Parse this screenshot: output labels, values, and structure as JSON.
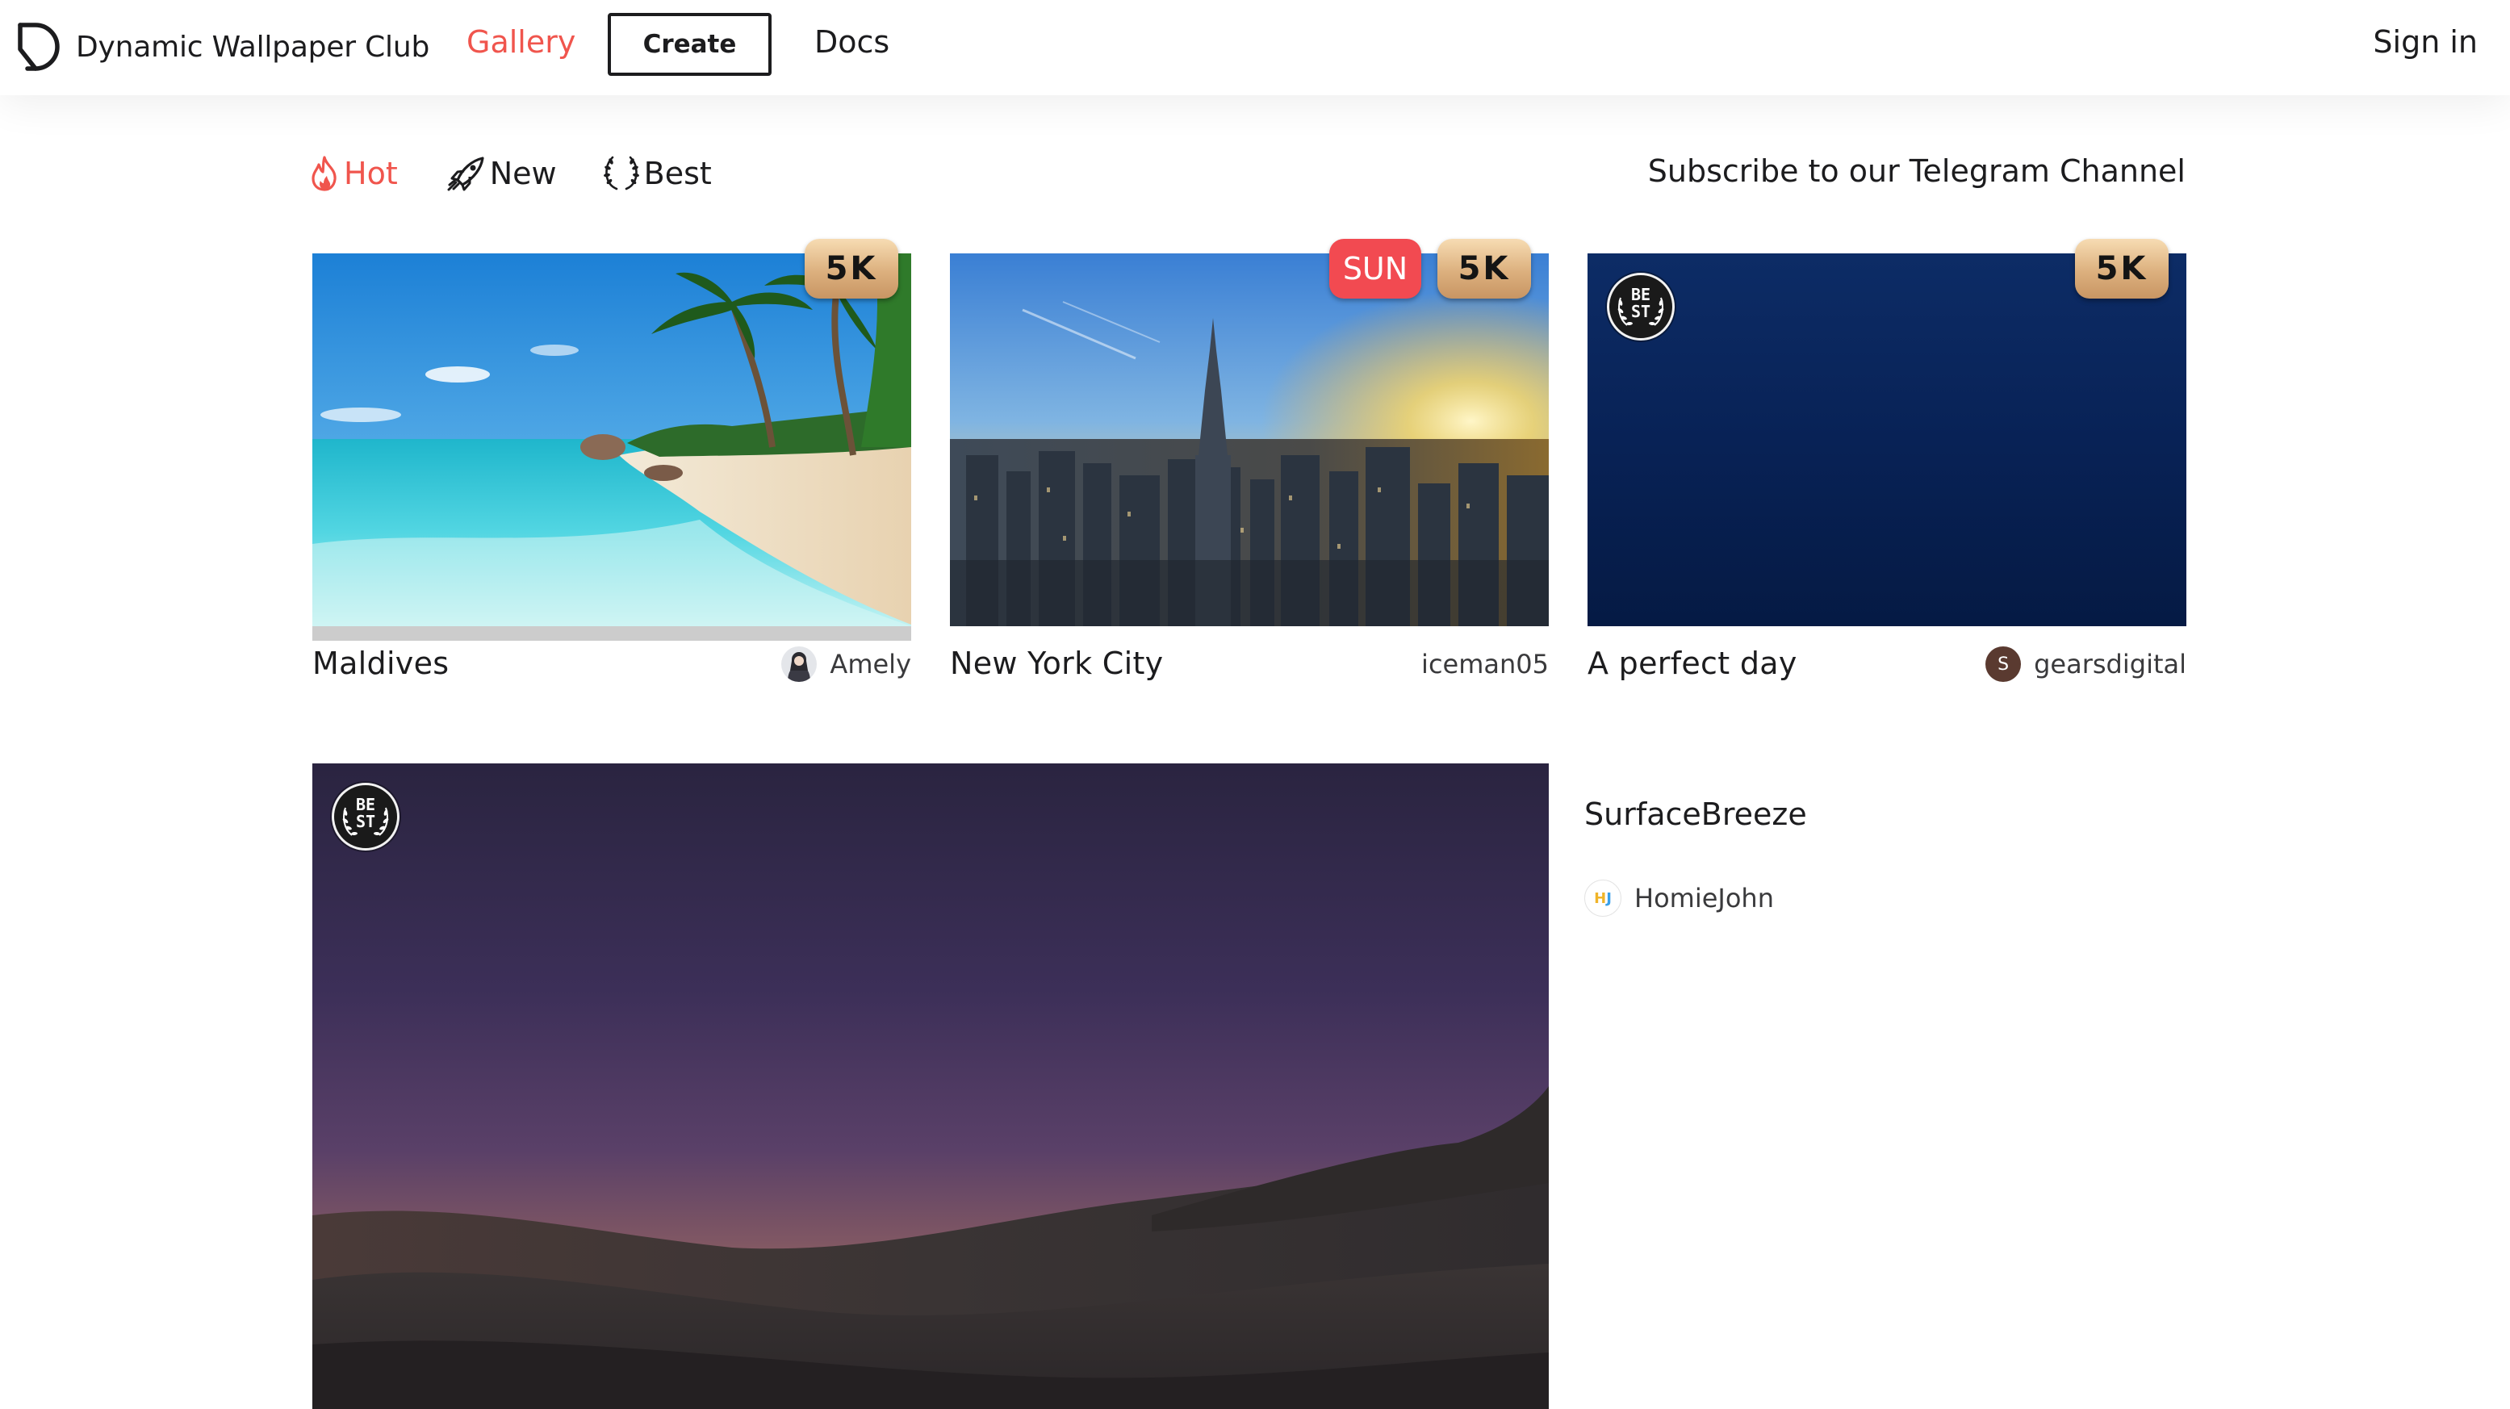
{
  "nav": {
    "brand": "Dynamic Wallpaper Club",
    "brand_icon": "club-logo-icon",
    "gallery": "Gallery",
    "create": "Create",
    "docs": "Docs",
    "sign_in": "Sign in",
    "active_color": "#f0554d"
  },
  "filters": {
    "hot": {
      "label": "Hot",
      "icon": "flame-icon",
      "active": true
    },
    "new": {
      "label": "New",
      "icon": "rocket-icon",
      "active": false
    },
    "best": {
      "label": "Best",
      "icon": "laurel-icon",
      "active": false
    },
    "subscribe": "Subscribe to our Telegram Channel"
  },
  "cards": [
    {
      "title": "Maldives",
      "author": "Amely",
      "badges": [
        "5K"
      ]
    },
    {
      "title": "New York City",
      "author": "iceman05",
      "badges": [
        "SUN",
        "5K"
      ]
    },
    {
      "title": "A perfect day",
      "author": "gearsdigital",
      "author_initial": "S",
      "badges": [
        "BEST",
        "5K"
      ]
    },
    {
      "title": "SurfaceBreeze",
      "author": "HomieJohn",
      "author_initials": "HJ",
      "badges": [
        "BEST"
      ]
    }
  ],
  "badges": {
    "resolution": "5K",
    "sun": "SUN",
    "best": "BE\nST"
  }
}
